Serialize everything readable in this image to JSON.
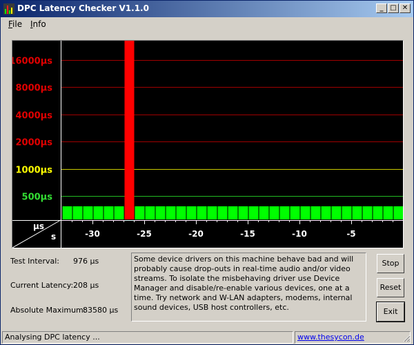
{
  "window": {
    "title": "DPC Latency Checker V1.1.0",
    "controls": {
      "minimize": "_",
      "maximize": "□",
      "close": "✕"
    }
  },
  "menu": [
    {
      "label": "File",
      "underline": "F",
      "rest": "ile"
    },
    {
      "label": "Info",
      "underline": "I",
      "rest": "nfo"
    }
  ],
  "chart_data": {
    "type": "bar",
    "y_axis_labels": [
      {
        "label": "16000µs",
        "value": 16000,
        "color": "#e00000"
      },
      {
        "label": "8000µs",
        "value": 8000,
        "color": "#e00000"
      },
      {
        "label": "4000µs",
        "value": 4000,
        "color": "#e00000"
      },
      {
        "label": "2000µs",
        "value": 2000,
        "color": "#e00000"
      },
      {
        "label": "1000µs",
        "value": 1000,
        "color": "#ffff00"
      },
      {
        "label": "500µs",
        "value": 500,
        "color": "#33dd33"
      }
    ],
    "corner_labels": {
      "y_unit": "µs",
      "x_unit": "s"
    },
    "x_ticks": [
      "-30",
      "-25",
      "-20",
      "-15",
      "-10",
      "-5"
    ],
    "values": [
      208,
      208,
      230,
      208,
      208,
      208,
      83580,
      208,
      208,
      208,
      208,
      208,
      208,
      208,
      230,
      208,
      208,
      208,
      208,
      208,
      208,
      250,
      208,
      208,
      208,
      208,
      208,
      208,
      208,
      208,
      208,
      208,
      208,
      208,
      208,
      208
    ],
    "colors": {
      "normal": "#00ff00",
      "alert": "#ff0000"
    },
    "scale": "log"
  },
  "stats": {
    "test_interval_label": "Test Interval:",
    "test_interval_value": "976 µs",
    "current_latency_label": "Current Latency:",
    "current_latency_value": "208 µs",
    "absolute_maximum_label": "Absolute Maximum:",
    "absolute_maximum_value": "83580 µs"
  },
  "message": "Some device drivers on this machine behave bad and will probably cause drop-outs in real-time audio and/or video streams. To isolate the misbehaving driver use Device Manager and disable/re-enable various devices, one at a time. Try network and W-LAN adapters, modems, internal sound devices, USB host controllers, etc.",
  "buttons": {
    "stop": "Stop",
    "reset": "Reset",
    "exit": "Exit"
  },
  "status": {
    "text": "Analysing DPC latency ...",
    "link": "www.thesycon.de"
  }
}
